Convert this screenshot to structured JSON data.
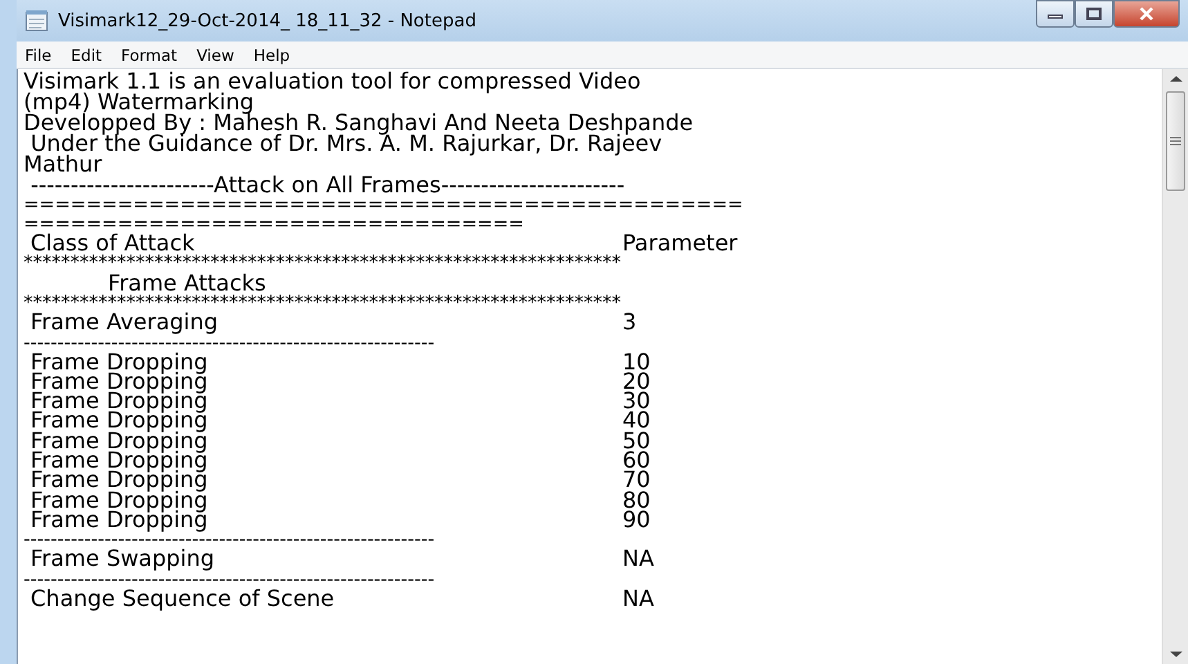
{
  "window": {
    "title": "Visimark12_29-Oct-2014_ 18_11_32 - Notepad"
  },
  "menu": [
    "File",
    "Edit",
    "Format",
    "View",
    "Help"
  ],
  "lines": [
    {
      "kind": "text",
      "text": "Visimark 1.1 is an evaluation tool for compressed Video"
    },
    {
      "kind": "text",
      "text": "(mp4) Watermarking"
    },
    {
      "kind": "text",
      "text": "Developped By : Mahesh R. Sanghavi And Neeta Deshpande"
    },
    {
      "kind": "text",
      "text": " Under the Guidance of Dr. Mrs. A. M. Rajurkar, Dr. Rajeev"
    },
    {
      "kind": "text",
      "text": "Mathur"
    },
    {
      "kind": "text",
      "text": " -----------------------Attack on All Frames-----------------------"
    },
    {
      "kind": "rule",
      "text": "=============================================="
    },
    {
      "kind": "rule",
      "text": "================================"
    },
    {
      "kind": "row",
      "label": "Class of Attack",
      "value": "Parameter"
    },
    {
      "kind": "rule",
      "text": "****************************************************************"
    },
    {
      "kind": "text",
      "text": "            Frame Attacks"
    },
    {
      "kind": "rule",
      "text": "****************************************************************"
    },
    {
      "kind": "row",
      "label": "Frame Averaging",
      "value": "3"
    },
    {
      "kind": "rule",
      "text": "-------------------------------------------------------------"
    },
    {
      "kind": "row",
      "label": "Frame Dropping",
      "value": "10"
    },
    {
      "kind": "row",
      "label": "Frame Dropping",
      "value": "20"
    },
    {
      "kind": "row",
      "label": "Frame Dropping",
      "value": "30"
    },
    {
      "kind": "row",
      "label": "Frame Dropping",
      "value": "40"
    },
    {
      "kind": "row",
      "label": "Frame Dropping",
      "value": "50"
    },
    {
      "kind": "row",
      "label": "Frame Dropping",
      "value": "60"
    },
    {
      "kind": "row",
      "label": "Frame Dropping",
      "value": "70"
    },
    {
      "kind": "row",
      "label": "Frame Dropping",
      "value": "80"
    },
    {
      "kind": "row",
      "label": "Frame Dropping",
      "value": "90"
    },
    {
      "kind": "rule",
      "text": "-------------------------------------------------------------"
    },
    {
      "kind": "row",
      "label": "Frame Swapping",
      "value": "NA"
    },
    {
      "kind": "rule",
      "text": "-------------------------------------------------------------"
    },
    {
      "kind": "row",
      "label": "Change Sequence of Scene",
      "value": "NA"
    }
  ]
}
